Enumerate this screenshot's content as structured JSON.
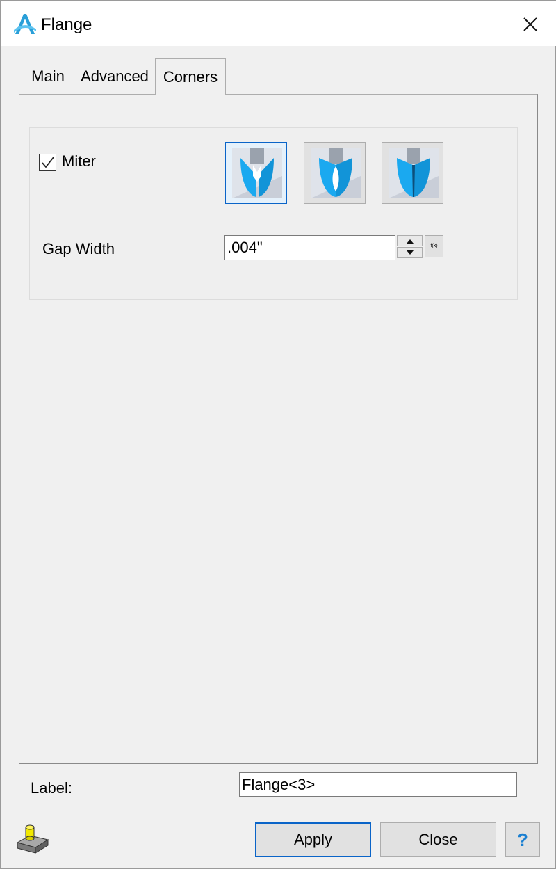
{
  "window": {
    "title": "Flange"
  },
  "tabs": [
    {
      "label": "Main"
    },
    {
      "label": "Advanced"
    },
    {
      "label": "Corners",
      "active": true
    }
  ],
  "corners": {
    "miter_checked": true,
    "miter_label": "Miter",
    "corner_types_selected_index": 0,
    "gap_width_label": "Gap Width",
    "gap_width_value": ".004\"",
    "fx_label": "f(x)"
  },
  "footer": {
    "label_caption": "Label:",
    "label_value": "Flange<3>",
    "apply_label": "Apply",
    "close_label": "Close",
    "help_label": "?"
  },
  "colors": {
    "accent": "#0a64c8",
    "icon_blue": "#1aa9f0",
    "help_blue": "#1a7fd1"
  },
  "icons": [
    "app-logo-icon",
    "close-icon",
    "checkmark-icon",
    "corner-miter-icon",
    "corner-round-icon",
    "corner-closed-icon",
    "spin-up-icon",
    "spin-down-icon",
    "part-feature-icon"
  ]
}
